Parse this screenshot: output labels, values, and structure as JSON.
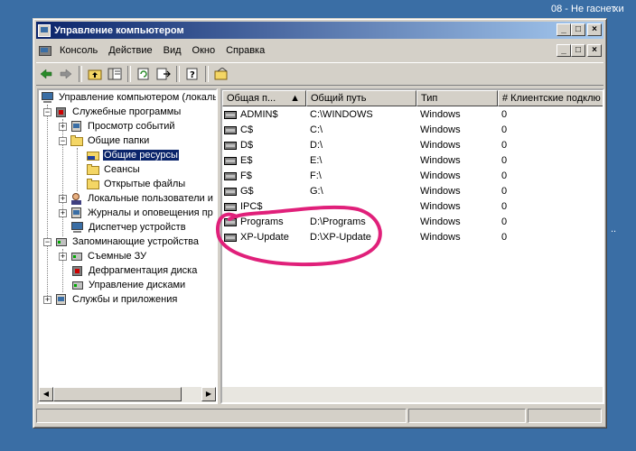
{
  "desktop": {
    "top_text_1": "08 - Не гаснет",
    "top_text_2": "хи",
    "side_text": ".."
  },
  "window": {
    "title": "Управление компьютером",
    "caption_buttons": [
      "_",
      "□",
      "×"
    ]
  },
  "menu": {
    "items": [
      "Консоль",
      "Действие",
      "Вид",
      "Окно",
      "Справка"
    ]
  },
  "toolbar": {
    "buttons": [
      "back-arrow-icon",
      "forward-arrow-icon",
      "up-folder-icon",
      "show-hide-tree-icon",
      "refresh-icon",
      "export-list-icon",
      "help-icon",
      "new-share-icon"
    ]
  },
  "tree": {
    "items": [
      {
        "label": "Управление компьютером (локаль"
      },
      {
        "label": "Служебные программы"
      },
      {
        "label": "Просмотр событий"
      },
      {
        "label": "Общие папки"
      },
      {
        "label": "Общие ресурсы"
      },
      {
        "label": "Сеансы"
      },
      {
        "label": "Открытые файлы"
      },
      {
        "label": "Локальные пользователи и"
      },
      {
        "label": "Журналы и оповещения пр"
      },
      {
        "label": "Диспетчер устройств"
      },
      {
        "label": "Запоминающие устройства"
      },
      {
        "label": "Съемные ЗУ"
      },
      {
        "label": "Дефрагментация диска"
      },
      {
        "label": "Управление дисками"
      },
      {
        "label": "Службы и приложения"
      }
    ]
  },
  "list": {
    "columns": [
      "Общая п...",
      "Общий путь",
      "Тип",
      "# Клиентские подклю"
    ],
    "rows": [
      {
        "name": "ADMIN$",
        "path": "C:\\WINDOWS",
        "type": "Windows",
        "clients": "0"
      },
      {
        "name": "C$",
        "path": "C:\\",
        "type": "Windows",
        "clients": "0"
      },
      {
        "name": "D$",
        "path": "D:\\",
        "type": "Windows",
        "clients": "0"
      },
      {
        "name": "E$",
        "path": "E:\\",
        "type": "Windows",
        "clients": "0"
      },
      {
        "name": "F$",
        "path": "F:\\",
        "type": "Windows",
        "clients": "0"
      },
      {
        "name": "G$",
        "path": "G:\\",
        "type": "Windows",
        "clients": "0"
      },
      {
        "name": "IPC$",
        "path": "",
        "type": "Windows",
        "clients": "0"
      },
      {
        "name": "Programs",
        "path": "D:\\Programs",
        "type": "Windows",
        "clients": "0"
      },
      {
        "name": "XP-Update",
        "path": "D:\\XP-Update",
        "type": "Windows",
        "clients": "0"
      }
    ]
  },
  "colors": {
    "desktop": "#3a6ea5",
    "title_start": "#0a246a",
    "title_end": "#a6caf0",
    "selection": "#0a246a",
    "annotation": "#e0207a"
  }
}
